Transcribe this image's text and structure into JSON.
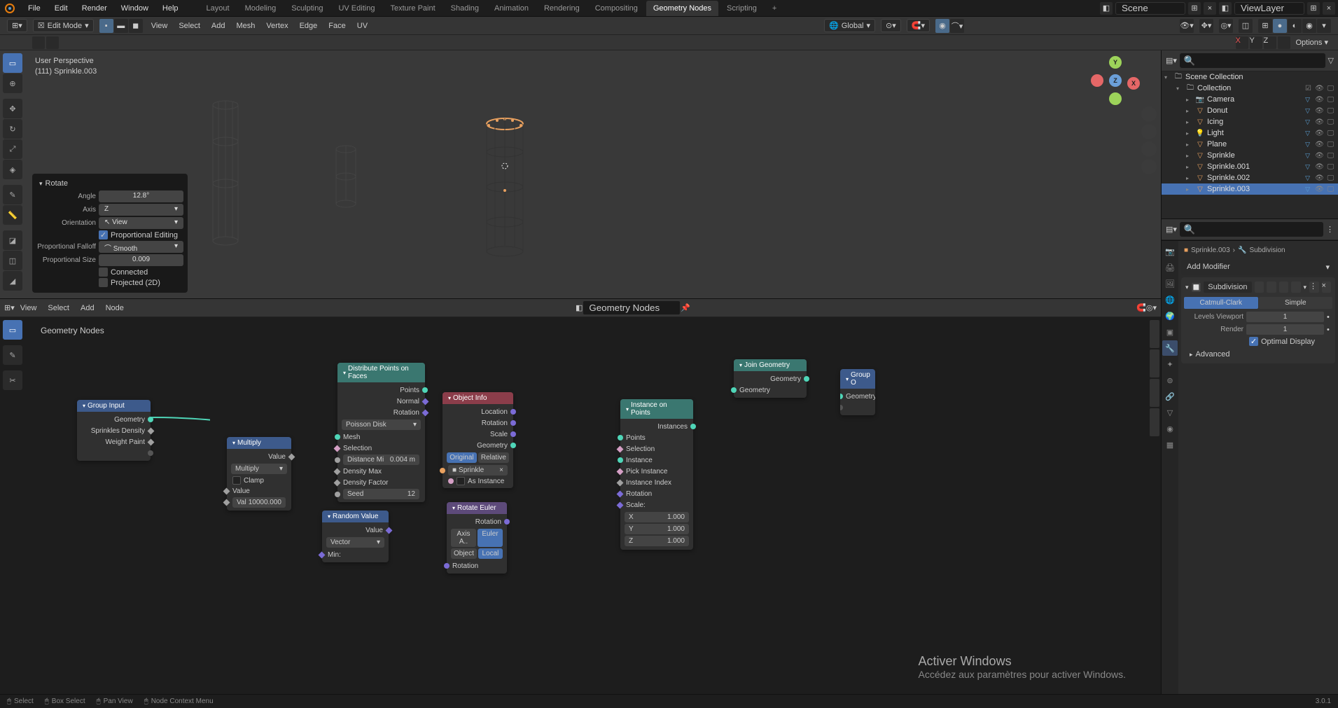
{
  "top_menu": {
    "items": [
      "File",
      "Edit",
      "Render",
      "Window",
      "Help"
    ],
    "workspaces": [
      "Layout",
      "Modeling",
      "Sculpting",
      "UV Editing",
      "Texture Paint",
      "Shading",
      "Animation",
      "Rendering",
      "Compositing",
      "Geometry Nodes",
      "Scripting"
    ],
    "active_workspace": 9,
    "scene_label": "Scene",
    "viewlayer_label": "ViewLayer"
  },
  "secondary": {
    "mode": "Edit Mode",
    "menus": [
      "View",
      "Select",
      "Add",
      "Mesh",
      "Vertex",
      "Edge",
      "Face",
      "UV"
    ],
    "orientation": "Global",
    "options": "Options"
  },
  "viewport": {
    "perspective": "User Perspective",
    "object": "(111) Sprinkle.003"
  },
  "rotate_panel": {
    "title": "Rotate",
    "angle_label": "Angle",
    "angle": "12.8°",
    "axis_label": "Axis",
    "axis": "Z",
    "orientation_label": "Orientation",
    "orientation": "View",
    "prop_edit": "Proportional Editing",
    "falloff_label": "Proportional Falloff",
    "falloff": "Smooth",
    "size_label": "Proportional Size",
    "size": "0.009",
    "connected": "Connected",
    "projected": "Projected (2D)"
  },
  "node_editor": {
    "header_menus": [
      "View",
      "Select",
      "Add",
      "Node"
    ],
    "tree_name": "Geometry Nodes",
    "title": "Geometry Nodes"
  },
  "nodes": {
    "group_input": {
      "title": "Group Input",
      "outputs": [
        "Geometry",
        "Sprinkles Density",
        "Weight Paint"
      ]
    },
    "multiply": {
      "title": "Multiply",
      "out_value": "Value",
      "operation": "Multiply",
      "clamp": "Clamp",
      "in_value": "Value",
      "val_label": "Val",
      "val": "10000.000"
    },
    "distribute": {
      "title": "Distribute Points on Faces",
      "outputs": [
        "Points",
        "Normal",
        "Rotation"
      ],
      "method": "Poisson Disk",
      "inputs": [
        "Mesh",
        "Selection"
      ],
      "dist_min_label": "Distance Mi",
      "dist_min": "0.004 m",
      "density_max": "Density Max",
      "density_factor": "Density Factor",
      "seed_label": "Seed",
      "seed": "12"
    },
    "object_info": {
      "title": "Object Info",
      "outputs": [
        "Location",
        "Rotation",
        "Scale",
        "Geometry"
      ],
      "original": "Original",
      "relative": "Relative",
      "object": "Sprinkle",
      "as_instance": "As Instance"
    },
    "random_value": {
      "title": "Random Value",
      "out": "Value",
      "type": "Vector",
      "min": "Min:"
    },
    "rotate_euler": {
      "title": "Rotate Euler",
      "out": "Rotation",
      "axis_angle": "Axis A..",
      "euler": "Euler",
      "object": "Object",
      "local": "Local",
      "rotation": "Rotation"
    },
    "instance": {
      "title": "Instance on Points",
      "out": "Instances",
      "inputs": [
        "Points",
        "Selection",
        "Instance",
        "Pick Instance",
        "Instance Index",
        "Rotation"
      ],
      "scale": "Scale:",
      "x": "X",
      "xv": "1.000",
      "y": "Y",
      "yv": "1.000",
      "z": "Z",
      "zv": "1.000"
    },
    "join": {
      "title": "Join Geometry",
      "out": "Geometry",
      "in": "Geometry"
    },
    "group_output": {
      "title": "Group O",
      "in": "Geometry"
    }
  },
  "outliner": {
    "scene_collection": "Scene Collection",
    "collection": "Collection",
    "items": [
      {
        "name": "Camera",
        "type": "camera"
      },
      {
        "name": "Donut",
        "type": "mesh"
      },
      {
        "name": "Icing",
        "type": "mesh"
      },
      {
        "name": "Light",
        "type": "light"
      },
      {
        "name": "Plane",
        "type": "mesh"
      },
      {
        "name": "Sprinkle",
        "type": "mesh"
      },
      {
        "name": "Sprinkle.001",
        "type": "mesh"
      },
      {
        "name": "Sprinkle.002",
        "type": "mesh"
      },
      {
        "name": "Sprinkle.003",
        "type": "mesh",
        "selected": true
      }
    ]
  },
  "properties": {
    "breadcrumb_obj": "Sprinkle.003",
    "breadcrumb_mod": "Subdivision",
    "add_modifier": "Add Modifier",
    "mod_name": "Subdivision",
    "catmull": "Catmull-Clark",
    "simple": "Simple",
    "levels_viewport_label": "Levels Viewport",
    "levels_viewport": "1",
    "render_label": "Render",
    "render": "1",
    "optimal_display": "Optimal Display",
    "advanced": "Advanced"
  },
  "status_bar": {
    "select": "Select",
    "box_select": "Box Select",
    "pan_view": "Pan View",
    "context_menu": "Node Context Menu"
  },
  "watermark": {
    "title": "Activer Windows",
    "subtitle": "Accédez aux paramètres pour activer Windows."
  },
  "version": "3.0.1"
}
